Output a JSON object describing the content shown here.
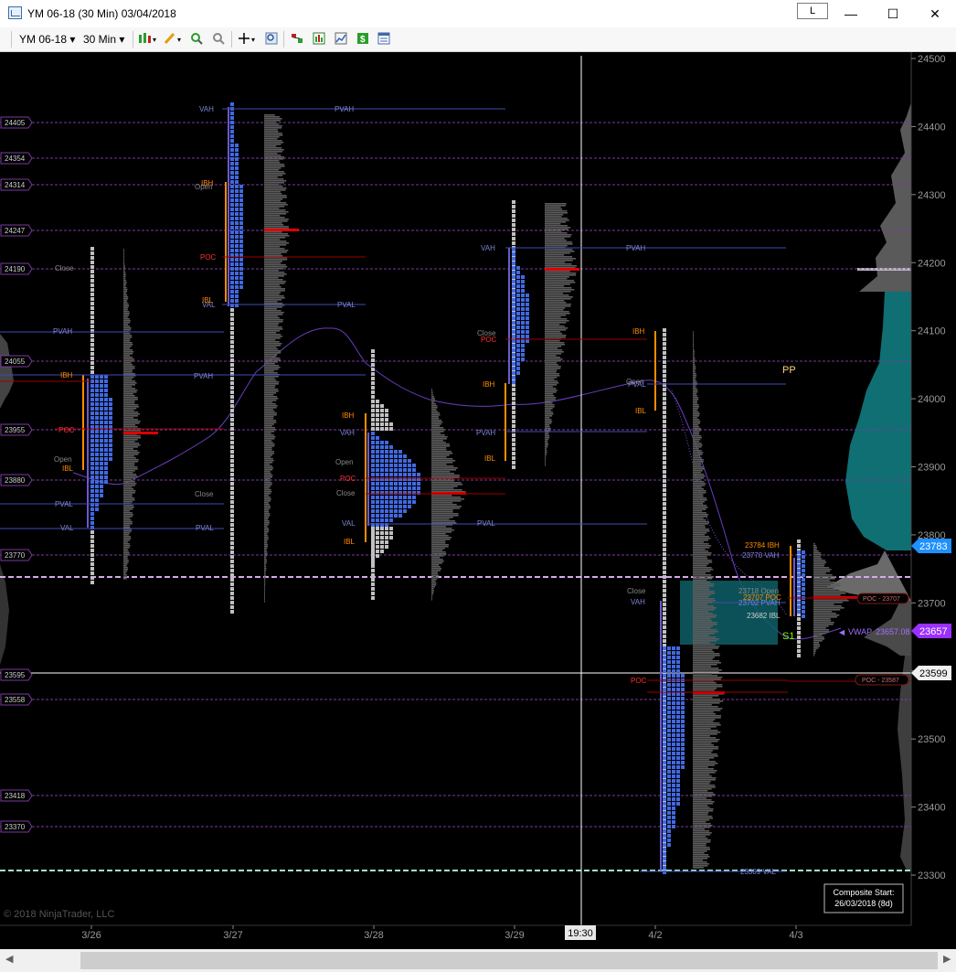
{
  "window": {
    "title": "YM 06-18 (30 Min)  03/04/2018",
    "link_button": "L",
    "minimize_icon": "minimize-icon",
    "maximize_icon": "maximize-icon",
    "close_icon": "close-icon"
  },
  "toolbar": {
    "instrument": "YM 06-18",
    "interval": "30 Min",
    "icons": [
      "bar-style-icon",
      "drawing-tools-icon",
      "zoom-in-icon",
      "zoom-out-icon",
      "crosshair-icon",
      "magnifier-icon",
      "strategies-icon",
      "indicators-icon",
      "chart-trader-icon",
      "dollar-icon",
      "properties-icon"
    ]
  },
  "chart": {
    "copyright": "© 2018 NinjaTrader, LLC",
    "composite_line1": "Composite Start:",
    "composite_line2": "26/03/2018 (8d)",
    "crosshair_time": "19:30",
    "pp_label": "PP",
    "s1_label": "S1",
    "vwap_label": "VWAP",
    "vwap_value": "23657.08",
    "poc_right_1": "POC - 23707",
    "poc_right_2": "POC - 23587",
    "price_badges": {
      "current": "23783",
      "vwap": "23657",
      "crosshair": "23599"
    },
    "level_labels": [
      "24405",
      "24354",
      "24314",
      "24247",
      "24190",
      "24055",
      "23955",
      "23880",
      "23770",
      "23595",
      "23558",
      "23418",
      "23370"
    ],
    "small_text": {
      "ibh_4_3": "23784 IBH",
      "vah_4_3": "23770 VAH",
      "open_4_3": "23718 Open",
      "pvah_4_3": "23702 PVAH",
      "poc_4_3": "23707 POC",
      "ibl_4_3": "23682 IBL",
      "val_4_2": "23309 VAL"
    },
    "session_tags": {
      "vah": "VAH",
      "val": "VAL",
      "pvah": "PVAH",
      "pval": "PVAL",
      "poc": "POC",
      "ibh": "IBH",
      "ibl": "IBL",
      "open": "Open",
      "close": "Close"
    }
  },
  "chart_data": {
    "type": "table",
    "instrument": "YM 06-18",
    "interval": "30 Min",
    "x_axis_dates": [
      "3/26",
      "3/27",
      "3/28",
      "3/29",
      "4/2",
      "4/3"
    ],
    "y_axis_ticks": [
      24500,
      24400,
      24300,
      24200,
      24100,
      24000,
      23900,
      23800,
      23700,
      23600,
      23500,
      23400,
      23300
    ],
    "ylim": [
      23290,
      24535
    ]
  },
  "colors": {
    "background": "#000000",
    "profile_blue": "#4169e1",
    "profile_gray": "#c0c0c0",
    "poc_red": "#e00000",
    "ib_orange": "#ff8c00",
    "value_blue": "#6a7bff",
    "vwap_purple": "#8a2be2",
    "current_price": "#1e90ff",
    "composite_teal": "#0f6f73"
  }
}
